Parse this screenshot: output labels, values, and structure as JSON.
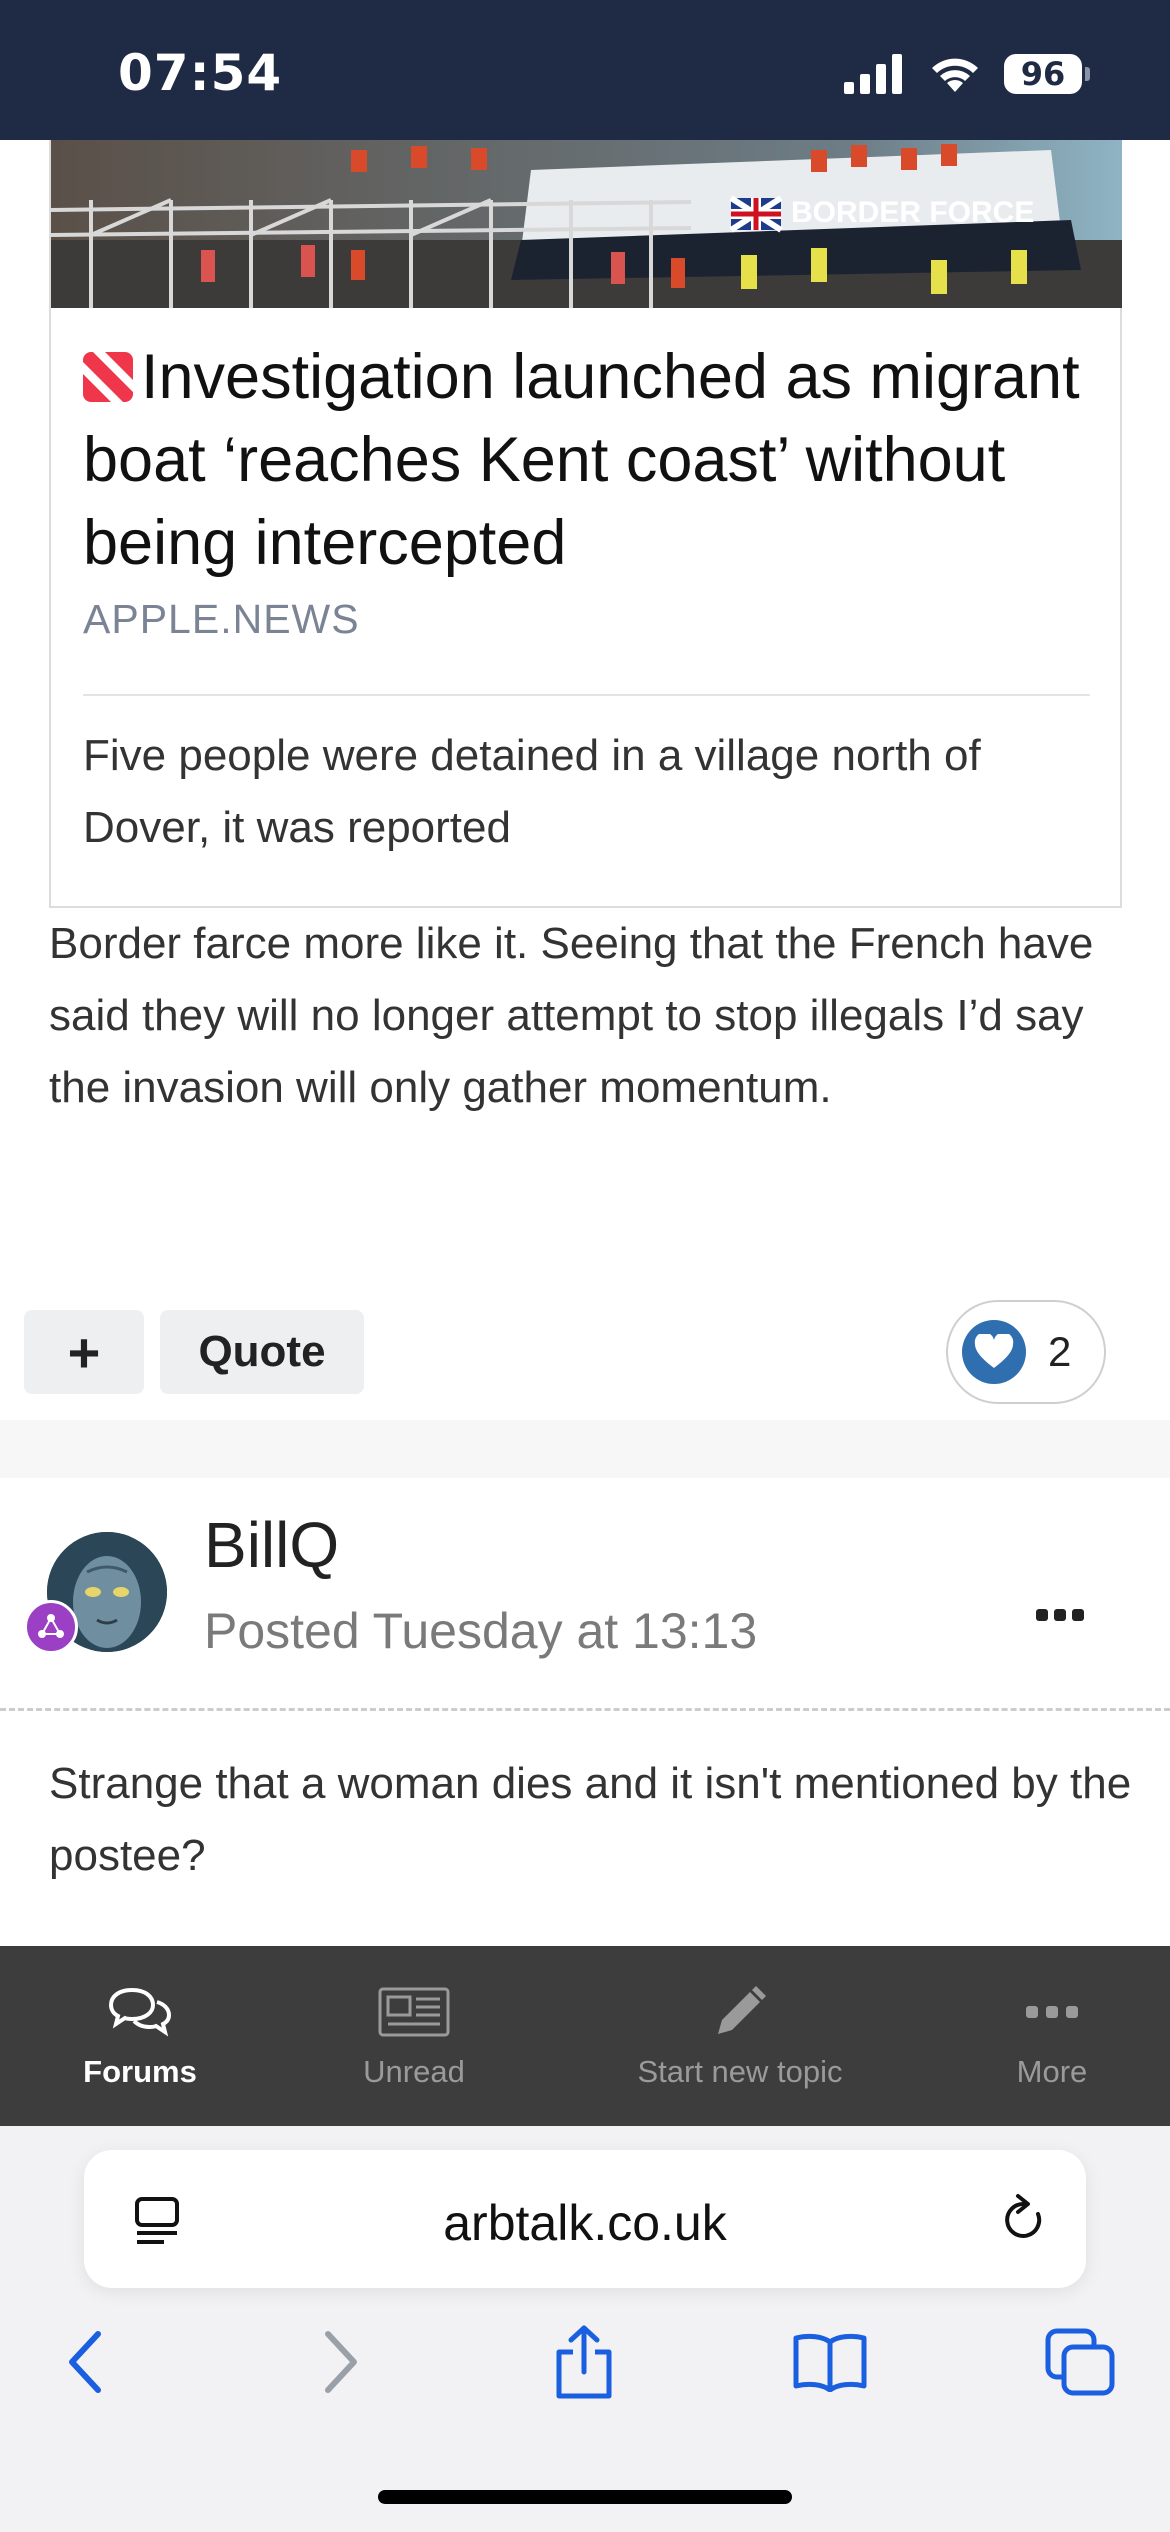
{
  "status_bar": {
    "time": "07:54",
    "battery": "96"
  },
  "link_card": {
    "title": "Investigation launched as migrant boat ‘reaches Kent coast’ without being intercepted",
    "source": "APPLE.NEWS",
    "description": "Five people were detained in a village north of Dover, it was reported",
    "image_text": "BORDER FORCE",
    "image_icon": "apple-news-logo-icon"
  },
  "post": {
    "text": "Border farce more like it. Seeing that the French have said they will no longer attempt to stop illegals I’d say the invasion will only gather momentum."
  },
  "actions": {
    "plus_label": "+",
    "quote_label": "Quote",
    "like_count": "2"
  },
  "next_post": {
    "author": "BillQ",
    "date": "Posted Tuesday at 13:13",
    "text": "Strange that a woman dies and it isn't mentioned by the postee?"
  },
  "forum_nav": {
    "items": [
      {
        "label": "Forums",
        "icon": "chat-bubbles-icon",
        "active": true
      },
      {
        "label": "Unread",
        "icon": "newspaper-icon",
        "active": false
      },
      {
        "label": "Start new topic",
        "icon": "pencil-icon",
        "active": false
      },
      {
        "label": "More",
        "icon": "ellipsis-icon",
        "active": false
      }
    ]
  },
  "browser": {
    "url": "arbtalk.co.uk",
    "toolbar": [
      "back-icon",
      "forward-icon",
      "share-icon",
      "bookmarks-icon",
      "tabs-icon"
    ]
  },
  "colors": {
    "status_bar_bg": "#1f2a44",
    "nav_bg": "#3d3d3d",
    "like_blue": "#2f6fb0",
    "link_blue": "#1a5fe0"
  }
}
